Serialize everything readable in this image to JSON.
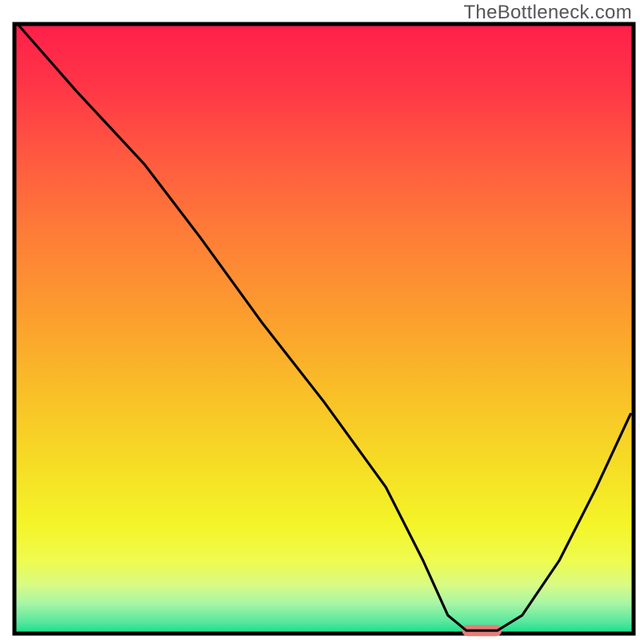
{
  "watermark": "TheBottleneck.com",
  "chart_data": {
    "type": "line",
    "title": "",
    "xlabel": "",
    "ylabel": "",
    "xlim": [
      0,
      100
    ],
    "ylim": [
      0,
      100
    ],
    "series": [
      {
        "name": "curve",
        "x": [
          0.5,
          10,
          21,
          30,
          40,
          50,
          60,
          66,
          70,
          73,
          78,
          82,
          88,
          94,
          99.5
        ],
        "y": [
          100,
          89,
          77,
          65,
          51,
          38,
          24,
          12,
          3,
          0.5,
          0.5,
          3,
          12,
          24,
          36
        ]
      }
    ],
    "marker": {
      "x_center": 75.5,
      "y": 0.5,
      "half_width": 3.2,
      "color": "#E77C7A"
    },
    "colors": {
      "frame": "#000000",
      "curve": "#000000"
    }
  }
}
